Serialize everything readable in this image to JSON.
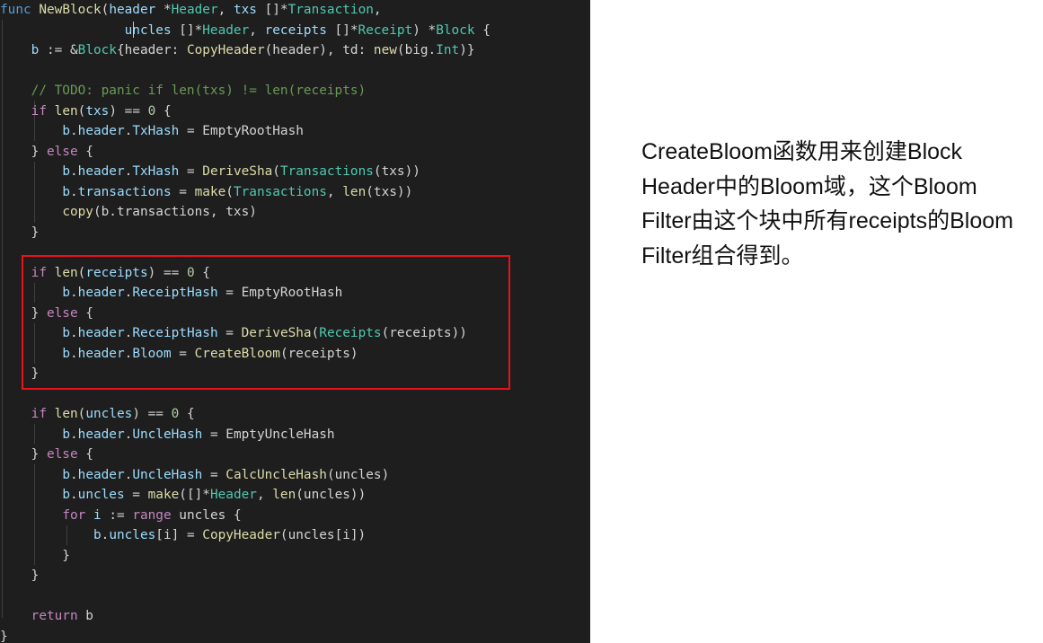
{
  "code_editor": {
    "language": "go",
    "lines": [
      [
        [
          "kw",
          "func"
        ],
        [
          "plain",
          " "
        ],
        [
          "fn",
          "NewBlock"
        ],
        [
          "plain",
          "("
        ],
        [
          "var",
          "header"
        ],
        [
          "plain",
          " *"
        ],
        [
          "typ",
          "Header"
        ],
        [
          "plain",
          ", "
        ],
        [
          "var",
          "txs"
        ],
        [
          "plain",
          " []*"
        ],
        [
          "typ",
          "Transaction"
        ],
        [
          "plain",
          ","
        ]
      ],
      [
        [
          "plain",
          "                "
        ],
        [
          "var",
          "uncles"
        ],
        [
          "plain",
          " []*"
        ],
        [
          "typ",
          "Header"
        ],
        [
          "plain",
          ", "
        ],
        [
          "var",
          "receipts"
        ],
        [
          "plain",
          " []*"
        ],
        [
          "typ",
          "Receipt"
        ],
        [
          "plain",
          ") *"
        ],
        [
          "typ",
          "Block"
        ],
        [
          "plain",
          " {"
        ]
      ],
      [
        [
          "plain",
          "    "
        ],
        [
          "var",
          "b"
        ],
        [
          "plain",
          " := &"
        ],
        [
          "typ",
          "Block"
        ],
        [
          "plain",
          "{header: "
        ],
        [
          "fn",
          "CopyHeader"
        ],
        [
          "plain",
          "(header), td: "
        ],
        [
          "fn",
          "new"
        ],
        [
          "plain",
          "(big."
        ],
        [
          "typ",
          "Int"
        ],
        [
          "plain",
          ")}"
        ]
      ],
      [
        [
          "plain",
          ""
        ]
      ],
      [
        [
          "plain",
          "    "
        ],
        [
          "cmt",
          "// TODO: panic if len(txs) != len(receipts)"
        ]
      ],
      [
        [
          "plain",
          "    "
        ],
        [
          "ctl",
          "if"
        ],
        [
          "plain",
          " "
        ],
        [
          "fn",
          "len"
        ],
        [
          "plain",
          "("
        ],
        [
          "var",
          "txs"
        ],
        [
          "plain",
          ") == "
        ],
        [
          "num",
          "0"
        ],
        [
          "plain",
          " {"
        ]
      ],
      [
        [
          "plain",
          "        "
        ],
        [
          "var",
          "b"
        ],
        [
          "plain",
          "."
        ],
        [
          "var",
          "header"
        ],
        [
          "plain",
          "."
        ],
        [
          "var",
          "TxHash"
        ],
        [
          "plain",
          " = EmptyRootHash"
        ]
      ],
      [
        [
          "plain",
          "    } "
        ],
        [
          "ctl",
          "else"
        ],
        [
          "plain",
          " {"
        ]
      ],
      [
        [
          "plain",
          "        "
        ],
        [
          "var",
          "b"
        ],
        [
          "plain",
          "."
        ],
        [
          "var",
          "header"
        ],
        [
          "plain",
          "."
        ],
        [
          "var",
          "TxHash"
        ],
        [
          "plain",
          " = "
        ],
        [
          "fn",
          "DeriveSha"
        ],
        [
          "plain",
          "("
        ],
        [
          "typ",
          "Transactions"
        ],
        [
          "plain",
          "(txs))"
        ]
      ],
      [
        [
          "plain",
          "        "
        ],
        [
          "var",
          "b"
        ],
        [
          "plain",
          "."
        ],
        [
          "var",
          "transactions"
        ],
        [
          "plain",
          " = "
        ],
        [
          "fn",
          "make"
        ],
        [
          "plain",
          "("
        ],
        [
          "typ",
          "Transactions"
        ],
        [
          "plain",
          ", "
        ],
        [
          "fn",
          "len"
        ],
        [
          "plain",
          "(txs))"
        ]
      ],
      [
        [
          "plain",
          "        "
        ],
        [
          "fn",
          "copy"
        ],
        [
          "plain",
          "(b.transactions, txs)"
        ]
      ],
      [
        [
          "plain",
          "    }"
        ]
      ],
      [
        [
          "plain",
          ""
        ]
      ],
      [
        [
          "plain",
          "    "
        ],
        [
          "ctl",
          "if"
        ],
        [
          "plain",
          " "
        ],
        [
          "fn",
          "len"
        ],
        [
          "plain",
          "("
        ],
        [
          "var",
          "receipts"
        ],
        [
          "plain",
          ") == "
        ],
        [
          "num",
          "0"
        ],
        [
          "plain",
          " {"
        ]
      ],
      [
        [
          "plain",
          "        "
        ],
        [
          "var",
          "b"
        ],
        [
          "plain",
          "."
        ],
        [
          "var",
          "header"
        ],
        [
          "plain",
          "."
        ],
        [
          "var",
          "ReceiptHash"
        ],
        [
          "plain",
          " = EmptyRootHash"
        ]
      ],
      [
        [
          "plain",
          "    } "
        ],
        [
          "ctl",
          "else"
        ],
        [
          "plain",
          " {"
        ]
      ],
      [
        [
          "plain",
          "        "
        ],
        [
          "var",
          "b"
        ],
        [
          "plain",
          "."
        ],
        [
          "var",
          "header"
        ],
        [
          "plain",
          "."
        ],
        [
          "var",
          "ReceiptHash"
        ],
        [
          "plain",
          " = "
        ],
        [
          "fn",
          "DeriveSha"
        ],
        [
          "plain",
          "("
        ],
        [
          "typ",
          "Receipts"
        ],
        [
          "plain",
          "(receipts))"
        ]
      ],
      [
        [
          "plain",
          "        "
        ],
        [
          "var",
          "b"
        ],
        [
          "plain",
          "."
        ],
        [
          "var",
          "header"
        ],
        [
          "plain",
          "."
        ],
        [
          "var",
          "Bloom"
        ],
        [
          "plain",
          " = "
        ],
        [
          "fn",
          "CreateBloom"
        ],
        [
          "plain",
          "(receipts)"
        ]
      ],
      [
        [
          "plain",
          "    }"
        ]
      ],
      [
        [
          "plain",
          ""
        ]
      ],
      [
        [
          "plain",
          "    "
        ],
        [
          "ctl",
          "if"
        ],
        [
          "plain",
          " "
        ],
        [
          "fn",
          "len"
        ],
        [
          "plain",
          "("
        ],
        [
          "var",
          "uncles"
        ],
        [
          "plain",
          ") == "
        ],
        [
          "num",
          "0"
        ],
        [
          "plain",
          " {"
        ]
      ],
      [
        [
          "plain",
          "        "
        ],
        [
          "var",
          "b"
        ],
        [
          "plain",
          "."
        ],
        [
          "var",
          "header"
        ],
        [
          "plain",
          "."
        ],
        [
          "var",
          "UncleHash"
        ],
        [
          "plain",
          " = EmptyUncleHash"
        ]
      ],
      [
        [
          "plain",
          "    } "
        ],
        [
          "ctl",
          "else"
        ],
        [
          "plain",
          " {"
        ]
      ],
      [
        [
          "plain",
          "        "
        ],
        [
          "var",
          "b"
        ],
        [
          "plain",
          "."
        ],
        [
          "var",
          "header"
        ],
        [
          "plain",
          "."
        ],
        [
          "var",
          "UncleHash"
        ],
        [
          "plain",
          " = "
        ],
        [
          "fn",
          "CalcUncleHash"
        ],
        [
          "plain",
          "(uncles)"
        ]
      ],
      [
        [
          "plain",
          "        "
        ],
        [
          "var",
          "b"
        ],
        [
          "plain",
          "."
        ],
        [
          "var",
          "uncles"
        ],
        [
          "plain",
          " = "
        ],
        [
          "fn",
          "make"
        ],
        [
          "plain",
          "([]*"
        ],
        [
          "typ",
          "Header"
        ],
        [
          "plain",
          ", "
        ],
        [
          "fn",
          "len"
        ],
        [
          "plain",
          "(uncles))"
        ]
      ],
      [
        [
          "plain",
          "        "
        ],
        [
          "ctl",
          "for"
        ],
        [
          "plain",
          " "
        ],
        [
          "var",
          "i"
        ],
        [
          "plain",
          " := "
        ],
        [
          "ctl",
          "range"
        ],
        [
          "plain",
          " uncles {"
        ]
      ],
      [
        [
          "plain",
          "            "
        ],
        [
          "var",
          "b"
        ],
        [
          "plain",
          "."
        ],
        [
          "var",
          "uncles"
        ],
        [
          "plain",
          "[i] = "
        ],
        [
          "fn",
          "CopyHeader"
        ],
        [
          "plain",
          "(uncles[i])"
        ]
      ],
      [
        [
          "plain",
          "        }"
        ]
      ],
      [
        [
          "plain",
          "    }"
        ]
      ],
      [
        [
          "plain",
          ""
        ]
      ],
      [
        [
          "plain",
          "    "
        ],
        [
          "ctl",
          "return"
        ],
        [
          "plain",
          " b"
        ]
      ],
      [
        [
          "plain",
          "}"
        ]
      ]
    ]
  },
  "annotation": {
    "lines": [
      "CreateBloom函数用来创建Block",
      "Header中的Bloom域，这个Bloom",
      "Filter由这个块中所有receipts的Bloom",
      "Filter组合得到。"
    ]
  },
  "colors": {
    "editor_background": "#1e1e1e",
    "highlight_border": "#e8121a",
    "keyword": "#569cd6",
    "control": "#c586c0",
    "function": "#dcdcaa",
    "variable": "#9cdcfe",
    "type": "#4ec9b0",
    "number": "#b5cea8",
    "comment": "#6a9955"
  }
}
